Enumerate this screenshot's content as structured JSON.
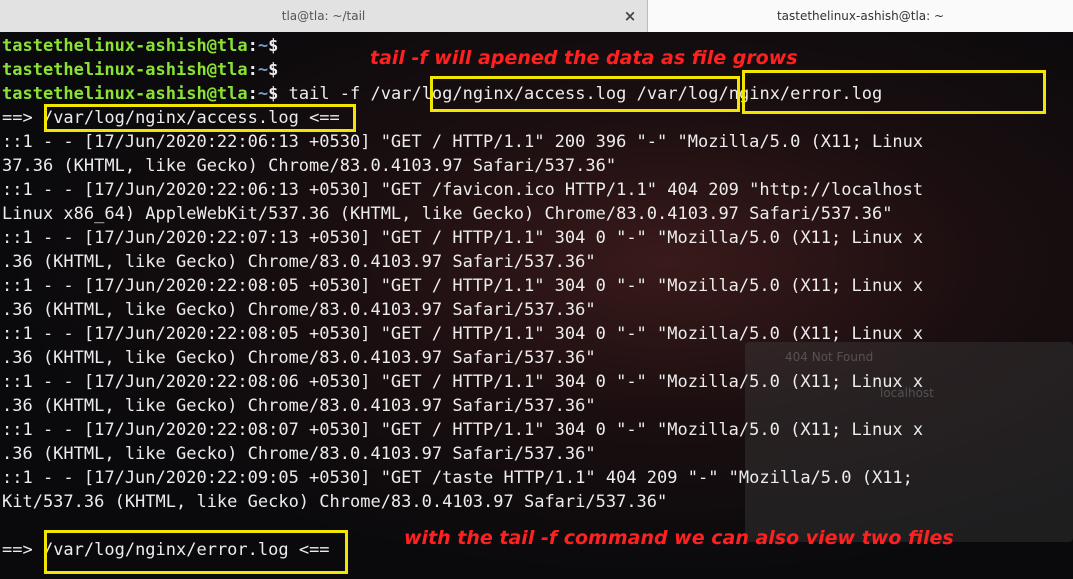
{
  "tabs": [
    {
      "label": "tla@tla: ~/tail"
    },
    {
      "label": "tastethelinux-ashish@tla: ~"
    }
  ],
  "close_icon": "×",
  "prompt": {
    "user": "tastethelinux-ashish@tla",
    "sep": ":",
    "path": "~",
    "sym": "$"
  },
  "command": {
    "text": " tail -f ",
    "file1": "/var/log/nginx/access.log",
    "file2": "/var/log/nginx/error.log"
  },
  "header_access": {
    "pre": "==> ",
    "file": "/var/log/nginx/access.log",
    "post": " <=="
  },
  "log_lines": [
    "::1 - - [17/Jun/2020:22:06:13 +0530] \"GET / HTTP/1.1\" 200 396 \"-\" \"Mozilla/5.0 (X11; Linux",
    "37.36 (KHTML, like Gecko) Chrome/83.0.4103.97 Safari/537.36\"",
    "::1 - - [17/Jun/2020:22:06:13 +0530] \"GET /favicon.ico HTTP/1.1\" 404 209 \"http://localhost",
    "Linux x86_64) AppleWebKit/537.36 (KHTML, like Gecko) Chrome/83.0.4103.97 Safari/537.36\"",
    "::1 - - [17/Jun/2020:22:07:13 +0530] \"GET / HTTP/1.1\" 304 0 \"-\" \"Mozilla/5.0 (X11; Linux x",
    ".36 (KHTML, like Gecko) Chrome/83.0.4103.97 Safari/537.36\"",
    "::1 - - [17/Jun/2020:22:08:05 +0530] \"GET / HTTP/1.1\" 304 0 \"-\" \"Mozilla/5.0 (X11; Linux x",
    ".36 (KHTML, like Gecko) Chrome/83.0.4103.97 Safari/537.36\"",
    "::1 - - [17/Jun/2020:22:08:05 +0530] \"GET / HTTP/1.1\" 304 0 \"-\" \"Mozilla/5.0 (X11; Linux x",
    ".36 (KHTML, like Gecko) Chrome/83.0.4103.97 Safari/537.36\"",
    "::1 - - [17/Jun/2020:22:08:06 +0530] \"GET / HTTP/1.1\" 304 0 \"-\" \"Mozilla/5.0 (X11; Linux x",
    ".36 (KHTML, like Gecko) Chrome/83.0.4103.97 Safari/537.36\"",
    "::1 - - [17/Jun/2020:22:08:07 +0530] \"GET / HTTP/1.1\" 304 0 \"-\" \"Mozilla/5.0 (X11; Linux x",
    ".36 (KHTML, like Gecko) Chrome/83.0.4103.97 Safari/537.36\"",
    "::1 - - [17/Jun/2020:22:09:05 +0530] \"GET /taste HTTP/1.1\" 404 209 \"-\" \"Mozilla/5.0 (X11;",
    "Kit/537.36 (KHTML, like Gecko) Chrome/83.0.4103.97 Safari/537.36\""
  ],
  "header_error": {
    "pre": "==> ",
    "file": "/var/log/nginx/error.log",
    "post": " <=="
  },
  "annotations": {
    "top": "tail -f will apened the data as file grows",
    "bottom": "with the tail -f command we can also view two files"
  },
  "background_ghost": {
    "tab_title": "404 Not Found",
    "url": "localhost"
  },
  "colors": {
    "prompt_user": "#8ae234",
    "prompt_path": "#729fcf",
    "highlight": "#f2e600",
    "annotation": "#ff2020"
  }
}
